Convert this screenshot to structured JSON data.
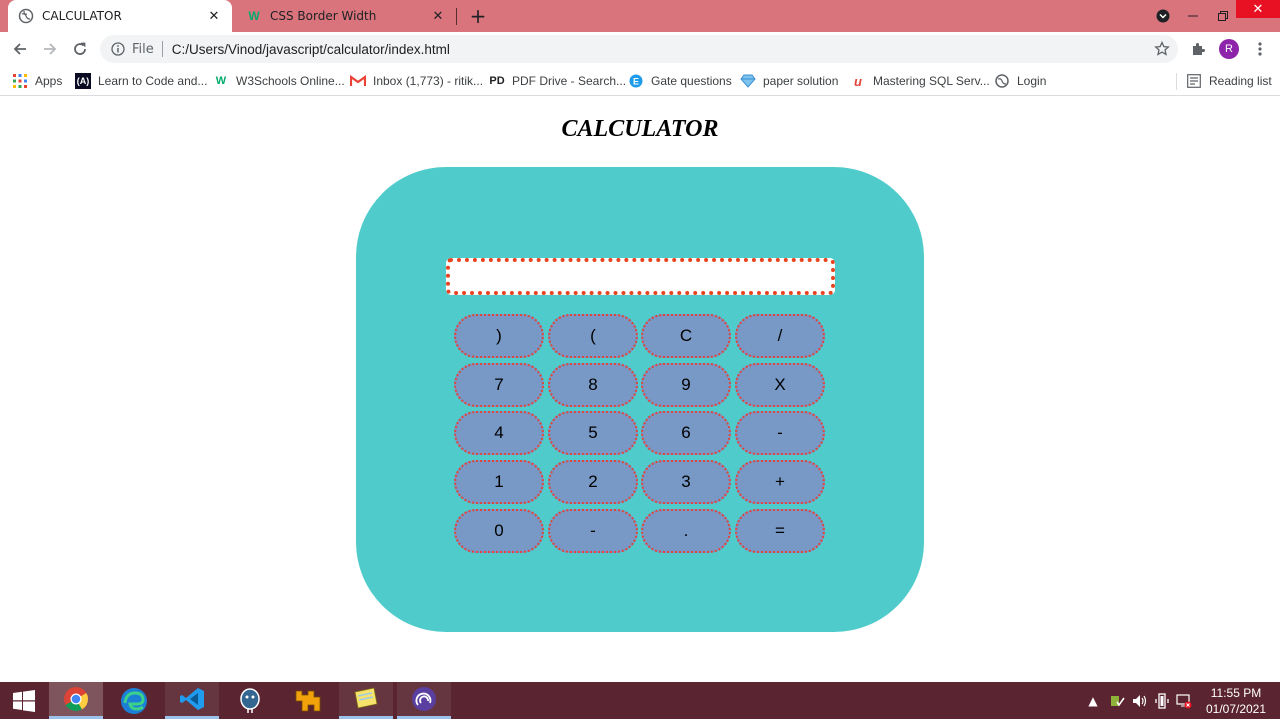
{
  "browser": {
    "tabs": [
      {
        "title": "CALCULATOR",
        "active": true
      },
      {
        "title": "CSS Border Width",
        "active": false
      }
    ],
    "address": {
      "scheme_label": "File",
      "url": "C:/Users/Vinod/javascript/calculator/index.html"
    },
    "profile_initial": "R",
    "bookmarks": [
      {
        "label": "Apps",
        "icon": "apps-grid-icon"
      },
      {
        "label": "Learn to Code and...",
        "icon": "freecodecamp-icon"
      },
      {
        "label": "W3Schools Online...",
        "icon": "w3schools-icon"
      },
      {
        "label": "Inbox (1,773) - ritik...",
        "icon": "gmail-icon"
      },
      {
        "label": "PDF Drive - Search...",
        "icon": "pdfdrive-icon"
      },
      {
        "label": "Gate questions",
        "icon": "gate-icon"
      },
      {
        "label": "paper solution",
        "icon": "diamond-icon"
      },
      {
        "label": "Mastering SQL Serv...",
        "icon": "udemy-icon"
      },
      {
        "label": "Login",
        "icon": "globe-icon"
      }
    ],
    "reading_list_label": "Reading list"
  },
  "page": {
    "title": "CALCULATOR",
    "display_value": "",
    "keys": [
      [
        ")",
        "(",
        "C",
        "/"
      ],
      [
        "7",
        "8",
        "9",
        "X"
      ],
      [
        "4",
        "5",
        "6",
        "-"
      ],
      [
        "1",
        "2",
        "3",
        "+"
      ],
      [
        "0",
        "-",
        ".",
        "="
      ]
    ]
  },
  "taskbar": {
    "time": "11:55 PM",
    "date": "01/07/2021"
  },
  "colors": {
    "tab_strip": "#d9747d",
    "calculator_body": "#50cbcb",
    "key_fill": "#7898c5",
    "key_border": "#e0443a",
    "display_border": "#e8441f",
    "taskbar": "#5a2530"
  }
}
